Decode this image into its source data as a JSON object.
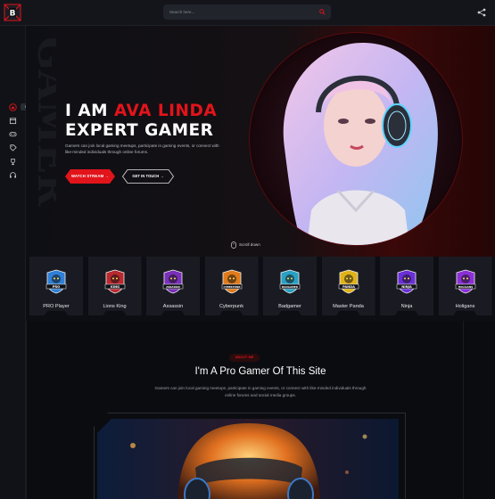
{
  "colors": {
    "accent": "#e1141b",
    "background": "#0b0c10",
    "panel": "#1a1b22"
  },
  "header": {
    "logo_letter": "B",
    "search_placeholder": "Search here..."
  },
  "sidebar": {
    "tooltip": "HOME",
    "icons": [
      "home-icon",
      "calendar-icon",
      "gamepad-icon",
      "tag-icon",
      "trophy-icon",
      "headphones-icon"
    ]
  },
  "hero": {
    "bg_word": "GAMER",
    "title_prefix": "I AM ",
    "title_name": "AVA LINDA",
    "title_line2": "EXPERT GAMER",
    "description": "Gamers can join local gaming meetups, participate in gaming events, or connect with like-minded individuals through online forums.",
    "watch_button": "WATCH STREAM →",
    "touch_button": "GET IN TOUCH →",
    "scroll_label": "Scroll down"
  },
  "players": [
    {
      "name": "PRO Player",
      "emblem": "pro-player-emblem",
      "badge": "PRO",
      "color": "#2f7fd6"
    },
    {
      "name": "Lions King",
      "emblem": "lions-king-emblem",
      "badge": "KING",
      "color": "#b8292f"
    },
    {
      "name": "Assassin",
      "emblem": "assassin-emblem",
      "badge": "ASSASSIN",
      "color": "#7a2fb8"
    },
    {
      "name": "Cyberpunk",
      "emblem": "cyberpunk-emblem",
      "badge": "CYBERPUNK",
      "color": "#e07b1a"
    },
    {
      "name": "Badgamer",
      "emblem": "badgamer-emblem",
      "badge": "BADGAMER",
      "color": "#2aa1c4"
    },
    {
      "name": "Master Panda",
      "emblem": "master-panda-emblem",
      "badge": "PANDA",
      "color": "#e0b21a"
    },
    {
      "name": "Ninja",
      "emblem": "ninja-emblem",
      "badge": "NINJA",
      "color": "#6a2fd6"
    },
    {
      "name": "Holigans",
      "emblem": "holigans-emblem",
      "badge": "HOLIGANS",
      "color": "#8b2fd6"
    }
  ],
  "about": {
    "badge": "ABOUT ME",
    "title": "I'm A Pro Gamer Of This Site",
    "description": "Gamers can join local gaming meetups, participate in gaming events, or connect with like-minded individuals through online forums and social media groups."
  }
}
